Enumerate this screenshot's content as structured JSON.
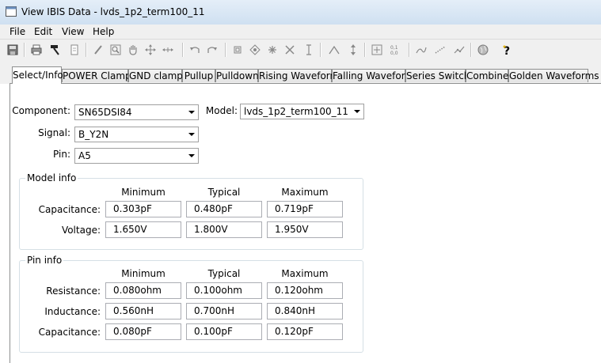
{
  "window": {
    "title": "View IBIS Data - lvds_1p2_term100_11"
  },
  "menu": {
    "items": [
      "File",
      "Edit",
      "View",
      "Help"
    ]
  },
  "toolbar": {
    "icons": [
      "save-icon",
      "print-icon",
      "hammer-icon",
      "document-icon",
      "pencil-icon",
      "zoom-box-icon",
      "hand-pan-icon",
      "move-icon",
      "fit-horizontal-icon",
      "undo-icon",
      "redo-icon",
      "square-marker-icon",
      "diamond-marker-icon",
      "star-marker-icon",
      "cross-marker-icon",
      "text-cursor-icon",
      "peak-icon",
      "vertical-arrows-icon",
      "zoom-fit-icon",
      "coordinates-icon",
      "line-style-1-icon",
      "line-style-2-icon",
      "line-style-3-icon",
      "globe-icon",
      "help-icon"
    ]
  },
  "tabs": [
    "Select/Info",
    "POWER Clamp",
    "GND clamp",
    "Pullup",
    "Pulldown",
    "Rising Waveform",
    "Falling Waveform",
    "Series Switch",
    "Combine",
    "Golden Waveforms"
  ],
  "selection": {
    "component_label": "Component:",
    "component_value": "SN65DSI84",
    "model_label": "Model:",
    "model_value": "lvds_1p2_term100_11",
    "signal_label": "Signal:",
    "signal_value": "B_Y2N",
    "pin_label": "Pin:",
    "pin_value": "A5"
  },
  "model_info": {
    "title": "Model info",
    "columns": [
      "Minimum",
      "Typical",
      "Maximum"
    ],
    "rows": [
      {
        "label": "Capacitance:",
        "values": [
          "0.303pF",
          "0.480pF",
          "0.719pF"
        ]
      },
      {
        "label": "Voltage:",
        "values": [
          "1.650V",
          "1.800V",
          "1.950V"
        ]
      }
    ]
  },
  "pin_info": {
    "title": "Pin info",
    "columns": [
      "Minimum",
      "Typical",
      "Maximum"
    ],
    "rows": [
      {
        "label": "Resistance:",
        "values": [
          "0.080ohm",
          "0.100ohm",
          "0.120ohm"
        ]
      },
      {
        "label": "Inductance:",
        "values": [
          "0.560nH",
          "0.700nH",
          "0.840nH"
        ]
      },
      {
        "label": "Capacitance:",
        "values": [
          "0.080pF",
          "0.100pF",
          "0.120pF"
        ]
      }
    ]
  }
}
